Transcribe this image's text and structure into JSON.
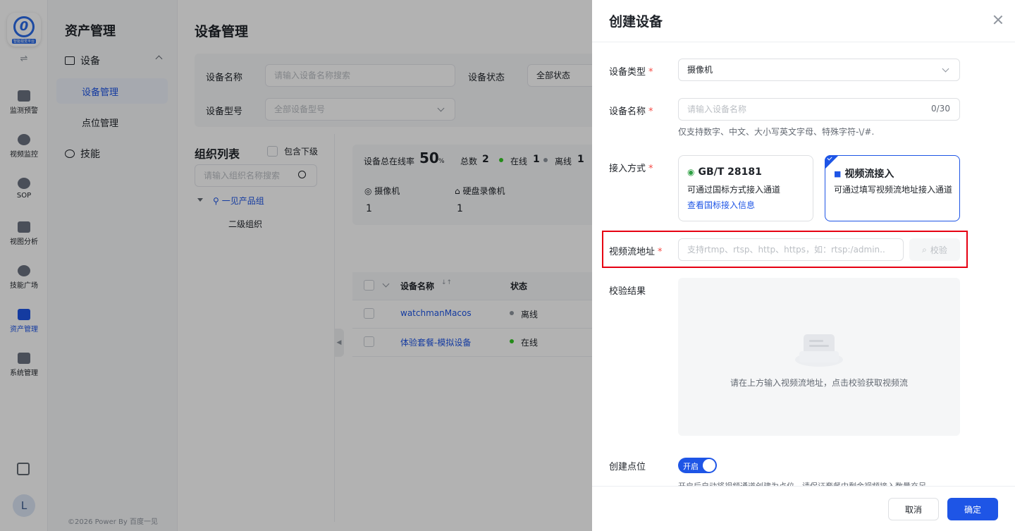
{
  "rail": {
    "logo_tag": "智能视觉平台",
    "items": [
      {
        "label": "监测预警",
        "icon": "chart-icon"
      },
      {
        "label": "视频监控",
        "icon": "camera-icon"
      },
      {
        "label": "SOP",
        "icon": "sop-icon"
      },
      {
        "label": "视图分析",
        "icon": "analysis-icon"
      },
      {
        "label": "技能广场",
        "icon": "skills-icon"
      },
      {
        "label": "资产管理",
        "icon": "asset-icon",
        "active": true
      },
      {
        "label": "系统管理",
        "icon": "system-icon"
      }
    ],
    "avatar": "L"
  },
  "nav2": {
    "title": "资产管理",
    "group": "设备",
    "subitems": [
      "设备管理",
      "点位管理"
    ],
    "skill": "技能",
    "copyright": "©2026 Power By 百度一见"
  },
  "main": {
    "title": "设备管理",
    "filters": {
      "name_label": "设备名称",
      "name_placeholder": "请输入设备名称搜索",
      "status_label": "设备状态",
      "status_value": "全部状态",
      "model_label": "设备型号",
      "model_value": "全部设备型号"
    },
    "org": {
      "title": "组织列表",
      "include_sub": "包含下级",
      "search_placeholder": "请输入组织名称搜索",
      "root": "一见产品组",
      "child": "二级组织"
    },
    "stats": {
      "online_rate_label": "设备总在线率",
      "online_rate_value": "50",
      "online_rate_unit": "%",
      "total_label": "总数",
      "total_value": "2",
      "online_label": "在线",
      "online_value": "1",
      "offline_label": "离线",
      "offline_value": "1",
      "camera_label": "摄像机",
      "camera_value": "1",
      "nvr_label": "硬盘录像机",
      "nvr_value": "1"
    },
    "table": {
      "headers": [
        "设备名称",
        "状态"
      ],
      "rows": [
        {
          "name": "watchmanMacos",
          "status": "离线"
        },
        {
          "name": "体验套餐-模拟设备",
          "status": "在线"
        }
      ]
    }
  },
  "drawer": {
    "title": "创建设备",
    "type_label": "设备类型",
    "type_value": "摄像机",
    "name_label": "设备名称",
    "name_placeholder": "请输入设备名称",
    "name_counter": "0/30",
    "name_hint": "仅支持数字、中文、大小写英文字母、特殊字符-\\/#.",
    "access_label": "接入方式",
    "access_cards": [
      {
        "title": "GB/T 28181",
        "desc": "可通过国标方式接入通道",
        "link": "查看国标接入信息"
      },
      {
        "title": "视频流接入",
        "desc": "可通过填写视频流地址接入通道",
        "selected": true
      }
    ],
    "stream_label": "视频流地址",
    "stream_placeholder": "支持rtmp、rtsp、http、https，如：rtsp:/admin..",
    "verify_label": "校验",
    "result_label": "校验结果",
    "result_empty": "请在上方输入视频流地址，点击校验获取视频流",
    "point_label": "创建点位",
    "toggle_label": "开启",
    "point_hint": "开启后自动将视频通道创建为点位，请保证套餐中剩余视频接入数量充足",
    "cancel": "取消",
    "confirm": "确定"
  },
  "colors": {
    "primary": "#1e55e6",
    "required": "#f54a45",
    "highlight": "#e60012",
    "online": "#34c724",
    "offline": "#8f959e"
  }
}
